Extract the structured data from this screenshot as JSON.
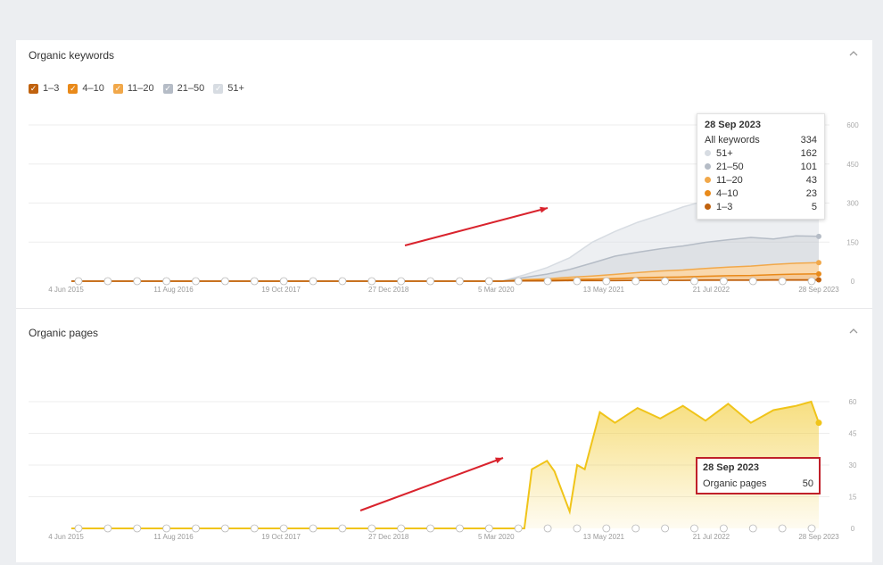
{
  "keywords_panel": {
    "title": "Organic keywords",
    "collapse_icon": "chevron-up-icon",
    "legend": [
      {
        "label": "1–3",
        "color": "#c0620e",
        "checked": true
      },
      {
        "label": "4–10",
        "color": "#e98a1a",
        "checked": true
      },
      {
        "label": "11–20",
        "color": "#f1a84a",
        "checked": true
      },
      {
        "label": "21–50",
        "color": "#b5bcc6",
        "checked": true
      },
      {
        "label": "51+",
        "color": "#d7dce2",
        "checked": true
      }
    ],
    "tooltip": {
      "date": "28 Sep 2023",
      "rows": [
        {
          "label": "All keywords",
          "value": "334"
        },
        {
          "label": "51+",
          "value": "162",
          "color": "#d7dce2"
        },
        {
          "label": "21–50",
          "value": "101",
          "color": "#b5bcc6"
        },
        {
          "label": "11–20",
          "value": "43",
          "color": "#f1a84a"
        },
        {
          "label": "4–10",
          "value": "23",
          "color": "#e98a1a"
        },
        {
          "label": "1–3",
          "value": "5",
          "color": "#c0620e"
        }
      ]
    }
  },
  "pages_panel": {
    "title": "Organic pages",
    "collapse_icon": "chevron-up-icon",
    "tooltip": {
      "date": "28 Sep 2023",
      "label": "Organic pages",
      "value": "50"
    }
  },
  "chart_data": [
    {
      "type": "area",
      "title": "Organic keywords",
      "x_ticks": [
        "4 Jun 2015",
        "11 Aug 2016",
        "19 Oct 2017",
        "27 Dec 2018",
        "5 Mar 2020",
        "13 May 2021",
        "21 Jul 2022",
        "28 Sep 2023"
      ],
      "y_ticks": [
        0,
        150,
        300,
        450,
        600
      ],
      "ylim": [
        0,
        600
      ],
      "x": [
        "2015-06",
        "2019-12",
        "2020-03",
        "2020-06",
        "2020-09",
        "2020-12",
        "2021-03",
        "2021-06",
        "2021-09",
        "2021-12",
        "2022-03",
        "2022-06",
        "2022-09",
        "2022-12",
        "2023-03",
        "2023-06",
        "2023-09"
      ],
      "stacked": true,
      "series": [
        {
          "name": "1–3",
          "color": "#c0620e",
          "values": [
            0,
            0,
            0,
            1,
            1,
            2,
            2,
            2,
            3,
            3,
            3,
            4,
            4,
            4,
            5,
            5,
            5
          ]
        },
        {
          "name": "4–10",
          "color": "#e98a1a",
          "values": [
            0,
            0,
            0,
            2,
            3,
            5,
            6,
            8,
            10,
            12,
            13,
            15,
            17,
            18,
            20,
            22,
            23
          ]
        },
        {
          "name": "11–20",
          "color": "#f1a84a",
          "values": [
            0,
            0,
            0,
            3,
            5,
            8,
            12,
            16,
            20,
            24,
            27,
            30,
            33,
            36,
            39,
            42,
            43
          ]
        },
        {
          "name": "21–50",
          "color": "#b5bcc6",
          "values": [
            0,
            0,
            0,
            8,
            18,
            30,
            50,
            70,
            78,
            85,
            92,
            100,
            105,
            110,
            98,
            105,
            101
          ]
        },
        {
          "name": "51+",
          "color": "#d7dce2",
          "values": [
            0,
            0,
            0,
            10,
            25,
            45,
            80,
            95,
            115,
            130,
            150,
            160,
            155,
            150,
            145,
            160,
            162
          ]
        }
      ],
      "grid": true
    },
    {
      "type": "area",
      "title": "Organic pages",
      "x_ticks": [
        "4 Jun 2015",
        "11 Aug 2016",
        "19 Oct 2017",
        "27 Dec 2018",
        "5 Mar 2020",
        "13 May 2021",
        "21 Jul 2022",
        "28 Sep 2023"
      ],
      "y_ticks": [
        0,
        15,
        30,
        45,
        60
      ],
      "ylim": [
        0,
        60
      ],
      "x": [
        "2015-06",
        "2020-06",
        "2020-07",
        "2020-09",
        "2020-10",
        "2020-12",
        "2021-01",
        "2021-02",
        "2021-04",
        "2021-06",
        "2021-09",
        "2021-12",
        "2022-03",
        "2022-06",
        "2022-09",
        "2022-12",
        "2023-03",
        "2023-06",
        "2023-08",
        "2023-09"
      ],
      "series": [
        {
          "name": "Organic pages",
          "color": "#f0c419",
          "values": [
            0,
            0,
            28,
            32,
            27,
            8,
            30,
            28,
            55,
            50,
            57,
            52,
            58,
            51,
            59,
            50,
            56,
            58,
            60,
            50
          ]
        }
      ],
      "grid": true
    }
  ]
}
